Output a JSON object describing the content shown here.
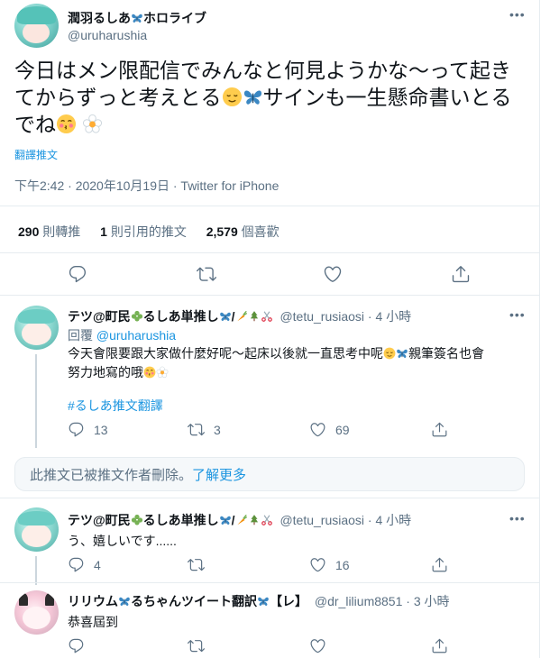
{
  "main_tweet": {
    "display_name": "潤羽るしあ",
    "name_suffix": "ホロライブ",
    "handle": "@uruharushia",
    "text_part1": "今日はメン限配信でみんなと何見ようかな～って起きてからずっと考えとる",
    "text_part2": "サインも一生懸命書いとるでね",
    "translate_label": "翻譯推文",
    "timestamp": "下午2:42 · 2020年10月19日 · Twitter for iPhone",
    "stats": {
      "retweets_count": "290",
      "retweets_label": "則轉推",
      "quotes_count": "1",
      "quotes_label": "則引用的推文",
      "likes_count": "2,579",
      "likes_label": "個喜歡"
    }
  },
  "replies": [
    {
      "display_name": "テツ@町民",
      "name_mid": "るしあ単推し",
      "handle_time": "@tetu_rusiaosi · 4 小時",
      "reply_to_prefix": "回覆",
      "reply_to_handle": "@uruharushia",
      "text_line1_a": "今天會限要跟大家做什麼好呢～起床以後就一直思考中呢",
      "text_line1_b": "親筆簽名也會",
      "text_line2": "努力地寫的哦",
      "hashtag": "#るしあ推文翻譯",
      "reply_count": "13",
      "retweet_count": "3",
      "like_count": "69"
    },
    {
      "display_name": "テツ@町民",
      "name_mid": "るしあ単推し",
      "handle_time": "@tetu_rusiaosi · 4 小時",
      "text": "う、嬉しいです......",
      "reply_count": "4",
      "like_count": "16"
    },
    {
      "display_name": "リリウム",
      "name_mid": "るちゃんツイート翻訳",
      "name_suffix": "【レ】",
      "handle_time": "@dr_lilium8851 · 3 小時",
      "text": "恭喜屆到"
    }
  ],
  "deleted_notice": {
    "text": "此推文已被推文作者刪除。",
    "link": "了解更多"
  },
  "icons": [
    "more-icon",
    "reply-icon",
    "retweet-icon",
    "like-icon",
    "share-icon",
    "butterfly-emoji",
    "relieved-face-emoji",
    "kissing-face-emoji",
    "blossom-emoji",
    "clover-emoji",
    "carrot-emoji",
    "tree-emoji",
    "scissors-emoji"
  ],
  "colors": {
    "accent": "#1b95e0",
    "muted": "#5b7083",
    "divider": "#e6ecf0",
    "text": "#0f1419"
  }
}
